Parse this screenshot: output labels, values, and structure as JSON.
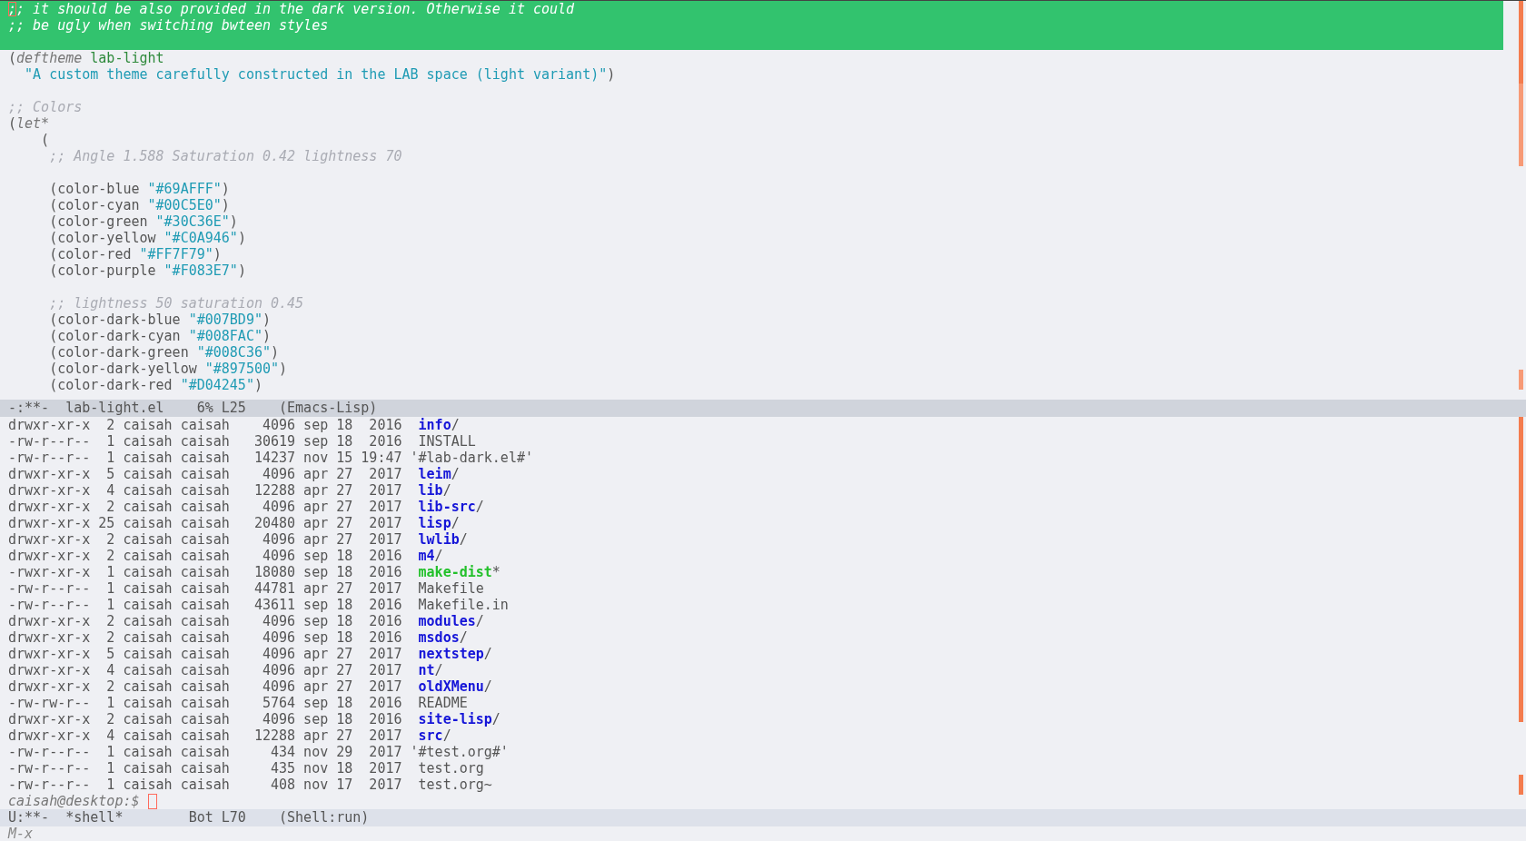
{
  "editor_window": {
    "lines": [
      {
        "highlighted": true,
        "segments": [
          {
            "kind": "comment",
            "text": ";; it should be also provided in the dark version. Otherwise it could"
          }
        ]
      },
      {
        "highlighted": true,
        "segments": [
          {
            "kind": "comment",
            "text": ";; be ugly when switching bwteen styles"
          }
        ]
      },
      {
        "highlighted": true
      },
      {
        "highlighted": false,
        "segments": [
          {
            "kind": "plain",
            "text": "("
          },
          {
            "kind": "keyword",
            "text": "deftheme"
          },
          {
            "kind": "name",
            "text": " lab-light"
          }
        ]
      },
      {
        "highlighted": false,
        "segments": [
          {
            "kind": "string",
            "text": "  \"A custom theme carefully constructed in the LAB space (light variant)\""
          },
          {
            "kind": "plain",
            "text": ")"
          }
        ]
      },
      {
        "highlighted": false
      },
      {
        "highlighted": false,
        "segments": [
          {
            "kind": "comment",
            "text": ";; Colors"
          }
        ]
      },
      {
        "highlighted": false,
        "segments": [
          {
            "kind": "plain",
            "text": "("
          },
          {
            "kind": "keyword",
            "text": "let*"
          }
        ]
      },
      {
        "highlighted": false,
        "segments": [
          {
            "kind": "plain",
            "text": "    ("
          }
        ]
      },
      {
        "highlighted": false,
        "segments": [
          {
            "kind": "comment",
            "text": "     ;; Angle 1.588 Saturation 0.42 lightness 70"
          }
        ]
      },
      {
        "highlighted": false
      },
      {
        "highlighted": false,
        "segments": [
          {
            "kind": "plain",
            "text": "     (color-blue "
          },
          {
            "kind": "string",
            "text": "\"#69AFFF\""
          },
          {
            "kind": "plain",
            "text": ")"
          }
        ]
      },
      {
        "highlighted": false,
        "segments": [
          {
            "kind": "plain",
            "text": "     (color-cyan "
          },
          {
            "kind": "string",
            "text": "\"#00C5E0\""
          },
          {
            "kind": "plain",
            "text": ")"
          }
        ]
      },
      {
        "highlighted": false,
        "segments": [
          {
            "kind": "plain",
            "text": "     (color-green "
          },
          {
            "kind": "string",
            "text": "\"#30C36E\""
          },
          {
            "kind": "plain",
            "text": ")"
          }
        ]
      },
      {
        "highlighted": false,
        "segments": [
          {
            "kind": "plain",
            "text": "     (color-yellow "
          },
          {
            "kind": "string",
            "text": "\"#C0A946\""
          },
          {
            "kind": "plain",
            "text": ")"
          }
        ]
      },
      {
        "highlighted": false,
        "segments": [
          {
            "kind": "plain",
            "text": "     (color-red "
          },
          {
            "kind": "string",
            "text": "\"#FF7F79\""
          },
          {
            "kind": "plain",
            "text": ")"
          }
        ]
      },
      {
        "highlighted": false,
        "segments": [
          {
            "kind": "plain",
            "text": "     (color-purple "
          },
          {
            "kind": "string",
            "text": "\"#F083E7\""
          },
          {
            "kind": "plain",
            "text": ")"
          }
        ]
      },
      {
        "highlighted": false
      },
      {
        "highlighted": false,
        "segments": [
          {
            "kind": "comment",
            "text": "     ;; lightness 50 saturation 0.45"
          }
        ]
      },
      {
        "highlighted": false,
        "segments": [
          {
            "kind": "plain",
            "text": "     (color-dark-blue "
          },
          {
            "kind": "string",
            "text": "\"#007BD9\""
          },
          {
            "kind": "plain",
            "text": ")"
          }
        ]
      },
      {
        "highlighted": false,
        "segments": [
          {
            "kind": "plain",
            "text": "     (color-dark-cyan "
          },
          {
            "kind": "string",
            "text": "\"#008FAC\""
          },
          {
            "kind": "plain",
            "text": ")"
          }
        ]
      },
      {
        "highlighted": false,
        "segments": [
          {
            "kind": "plain",
            "text": "     (color-dark-green "
          },
          {
            "kind": "string",
            "text": "\"#008C36\""
          },
          {
            "kind": "plain",
            "text": ")"
          }
        ]
      },
      {
        "highlighted": false,
        "segments": [
          {
            "kind": "plain",
            "text": "     (color-dark-yellow "
          },
          {
            "kind": "string",
            "text": "\"#897500\""
          },
          {
            "kind": "plain",
            "text": ")"
          }
        ]
      },
      {
        "highlighted": false,
        "segments": [
          {
            "kind": "plain",
            "text": "     (color-dark-red "
          },
          {
            "kind": "string",
            "text": "\"#D04245\""
          },
          {
            "kind": "plain",
            "text": ")"
          }
        ]
      }
    ],
    "mode_line": {
      "text": "-:**-  lab-light.el    6% L25    (Emacs-Lisp)",
      "active": false
    }
  },
  "shell_window": {
    "listing": [
      {
        "info": "drwxr-xr-x  2 caisah caisah    4096 sep 18  2016",
        "name": "info",
        "suffix": "/",
        "kind": "dir"
      },
      {
        "info": "-rw-r--r--  1 caisah caisah   30619 sep 18  2016",
        "name": "INSTALL",
        "kind": "file"
      },
      {
        "info": "-rw-r--r--  1 caisah caisah   14237 nov 15 19:47",
        "name": "'#lab-dark.el#'",
        "kind": "quoted"
      },
      {
        "info": "drwxr-xr-x  5 caisah caisah    4096 apr 27  2017",
        "name": "leim",
        "suffix": "/",
        "kind": "dir"
      },
      {
        "info": "drwxr-xr-x  4 caisah caisah   12288 apr 27  2017",
        "name": "lib",
        "suffix": "/",
        "kind": "dir"
      },
      {
        "info": "drwxr-xr-x  2 caisah caisah    4096 apr 27  2017",
        "name": "lib-src",
        "suffix": "/",
        "kind": "dir"
      },
      {
        "info": "drwxr-xr-x 25 caisah caisah   20480 apr 27  2017",
        "name": "lisp",
        "suffix": "/",
        "kind": "dir"
      },
      {
        "info": "drwxr-xr-x  2 caisah caisah    4096 apr 27  2017",
        "name": "lwlib",
        "suffix": "/",
        "kind": "dir"
      },
      {
        "info": "drwxr-xr-x  2 caisah caisah    4096 sep 18  2016",
        "name": "m4",
        "suffix": "/",
        "kind": "dir"
      },
      {
        "info": "-rwxr-xr-x  1 caisah caisah   18080 sep 18  2016",
        "name": "make-dist",
        "suffix": "*",
        "kind": "exec"
      },
      {
        "info": "-rw-r--r--  1 caisah caisah   44781 apr 27  2017",
        "name": "Makefile",
        "kind": "file"
      },
      {
        "info": "-rw-r--r--  1 caisah caisah   43611 sep 18  2016",
        "name": "Makefile.in",
        "kind": "file"
      },
      {
        "info": "drwxr-xr-x  2 caisah caisah    4096 sep 18  2016",
        "name": "modules",
        "suffix": "/",
        "kind": "dir"
      },
      {
        "info": "drwxr-xr-x  2 caisah caisah    4096 sep 18  2016",
        "name": "msdos",
        "suffix": "/",
        "kind": "dir"
      },
      {
        "info": "drwxr-xr-x  5 caisah caisah    4096 apr 27  2017",
        "name": "nextstep",
        "suffix": "/",
        "kind": "dir"
      },
      {
        "info": "drwxr-xr-x  4 caisah caisah    4096 apr 27  2017",
        "name": "nt",
        "suffix": "/",
        "kind": "dir"
      },
      {
        "info": "drwxr-xr-x  2 caisah caisah    4096 apr 27  2017",
        "name": "oldXMenu",
        "suffix": "/",
        "kind": "dir"
      },
      {
        "info": "-rw-rw-r--  1 caisah caisah    5764 sep 18  2016",
        "name": "README",
        "kind": "file"
      },
      {
        "info": "drwxr-xr-x  2 caisah caisah    4096 sep 18  2016",
        "name": "site-lisp",
        "suffix": "/",
        "kind": "dir"
      },
      {
        "info": "drwxr-xr-x  4 caisah caisah   12288 apr 27  2017",
        "name": "src",
        "suffix": "/",
        "kind": "dir"
      },
      {
        "info": "-rw-r--r--  1 caisah caisah     434 nov 29  2017",
        "name": "'#test.org#'",
        "kind": "quoted"
      },
      {
        "info": "-rw-r--r--  1 caisah caisah     435 nov 18  2017",
        "name": "test.org",
        "kind": "file"
      },
      {
        "info": "-rw-r--r--  1 caisah caisah     408 nov 17  2017",
        "name": "test.org~",
        "kind": "file"
      }
    ],
    "prompt": "caisah@desktop:$",
    "mode_line": {
      "text": "U:**-  *shell*        Bot L70    (Shell:run)",
      "active": true
    }
  },
  "minibuffer": "M-x"
}
